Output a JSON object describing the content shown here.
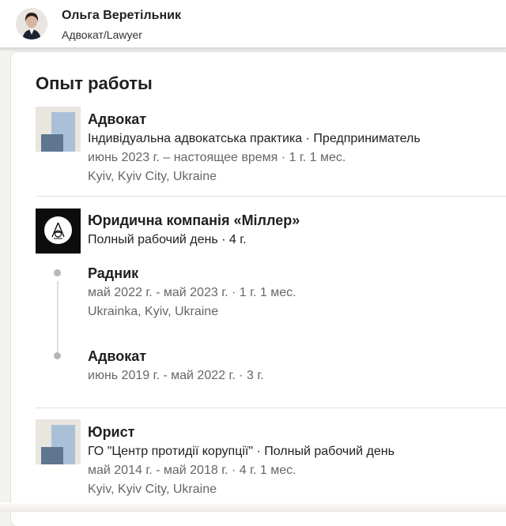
{
  "profile": {
    "name": "Ольга Веретільник",
    "headline": "Адвокат/Lawyer"
  },
  "section": {
    "title": "Опыт работы"
  },
  "experience": [
    {
      "title": "Адвокат",
      "company": "Індивідуальна адвокатська практика · Предприниматель",
      "dates": "июнь 2023 г. – настоящее время · 1 г. 1 мес.",
      "location": "Kyiv, Kyiv City, Ukraine"
    },
    {
      "company": "Юридична компанія «Міллер»",
      "employment": "Полный рабочий день · 4 г.",
      "roles": [
        {
          "title": "Радник",
          "dates": "май 2022 г. - май 2023 г. · 1 г. 1 мес.",
          "location": "Ukrainka, Kyiv, Ukraine"
        },
        {
          "title": "Адвокат",
          "dates": "июнь 2019 г. - май 2022 г. · 3 г."
        }
      ]
    },
    {
      "title": "Юрист",
      "company": "ГО \"Центр протидії корупції\" · Полный рабочий день",
      "dates": "май 2014 г. - май 2018 г. · 4 г. 1 мес.",
      "location": "Kyiv, Kyiv City, Ukraine"
    }
  ],
  "icons": {
    "company_logo_placeholder": "building-placeholder-icon",
    "miller_logo": "miller-law-firm-logo",
    "timeline_dot": "timeline-dot"
  },
  "colors": {
    "background": "#f3f2ef",
    "card": "#ffffff",
    "muted_text": "#666666",
    "logo_placeholder_light": "#a9c0d8",
    "logo_placeholder_dark": "#5e7690"
  }
}
